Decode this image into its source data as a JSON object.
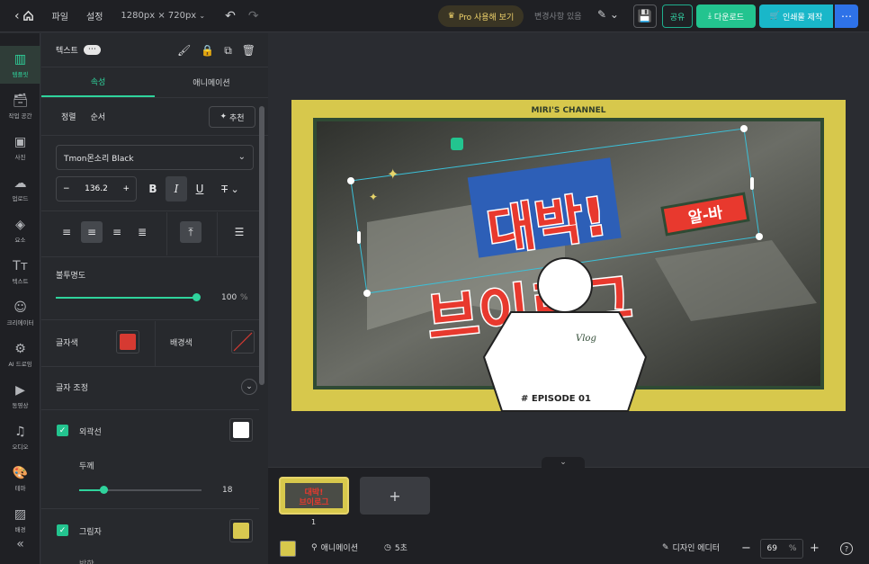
{
  "topbar": {
    "back_icon": "chevron-left-home-icon",
    "menu_file": "파일",
    "menu_settings": "설정",
    "canvas_size": "1280px × 720px",
    "pro_label": "Pro 사용해 보기",
    "saved_status": "변경사항 있음",
    "share_label": "공유",
    "download_label": "다운로드",
    "print_label": "인쇄물 제작"
  },
  "leftnav": {
    "items": [
      {
        "label": "템플릿",
        "icon": "template-icon"
      },
      {
        "label": "작업 공간",
        "icon": "workspace-icon"
      },
      {
        "label": "사진",
        "icon": "photo-icon"
      },
      {
        "label": "업로드",
        "icon": "upload-icon"
      },
      {
        "label": "요소",
        "icon": "elements-icon"
      },
      {
        "label": "텍스트",
        "icon": "text-icon"
      },
      {
        "label": "크리에이터",
        "icon": "creator-icon"
      },
      {
        "label": "AI 드로잉",
        "icon": "ai-drawing-icon"
      },
      {
        "label": "동영상",
        "icon": "video-icon"
      },
      {
        "label": "오디오",
        "icon": "audio-icon"
      },
      {
        "label": "테마",
        "icon": "theme-icon"
      },
      {
        "label": "배경",
        "icon": "background-icon"
      }
    ]
  },
  "panel": {
    "title": "텍스트",
    "tab_props": "속성",
    "tab_anim": "애니메이션",
    "sub_align": "정렬",
    "sub_order": "순서",
    "recommend": "추천",
    "font_name": "Tmon몬소리 Black",
    "font_size": "136.2",
    "opacity_label": "불투명도",
    "opacity_value": "100",
    "opacity_unit": "%",
    "text_color_label": "글자색",
    "text_color": "#d63a32",
    "bg_color_label": "배경색",
    "adjust_label": "글자 조정",
    "outline_label": "외곽선",
    "outline_color": "#ffffff",
    "thickness_label": "두께",
    "thickness_value": "18",
    "shadow_label": "그림자",
    "shadow_color": "#d9c950",
    "direction_label": "방향"
  },
  "canvas": {
    "channel": "MIRI'S CHANNEL",
    "title_line1": "대박!",
    "title_line2": "브이로그",
    "badge": "알-바",
    "shirt_text": "Vlog",
    "episode": "# EPISODE 01",
    "frame_color": "#d7c84c",
    "title_color": "#e8392e"
  },
  "bottom": {
    "page_number": "1",
    "add_page": "+",
    "animation_label": "애니메이션",
    "duration_label": "5초",
    "designer_label": "디자인 에디터",
    "zoom_value": "69",
    "zoom_unit": "%",
    "help": "?"
  }
}
